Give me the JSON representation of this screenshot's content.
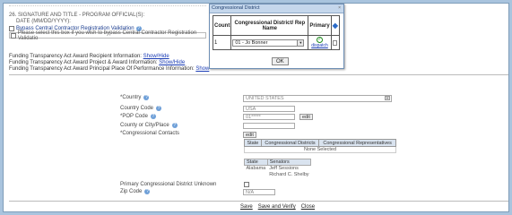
{
  "section": {
    "title": "26. SIGNATURE AND TITLE - PROGRAM OFFICIAL(S):",
    "date_label": "DATE (MM/DD/YYYY):",
    "bypass_title": "Bypass Central Contractor Registration Validation",
    "bypass_checkbox_label": "Please select this box if you wish to bypass Central Contractor Registration Validatio",
    "ffata": [
      {
        "label": "Funding Transparency Act Award Recipient Information:",
        "link": "Show/Hide"
      },
      {
        "label": "Funding Transparency Act Award Project & Award Information:",
        "link": "Show/Hide"
      },
      {
        "label": "Funding Transparency Act Award Principal Place Of Performance Information:",
        "link": "Show"
      }
    ]
  },
  "form": {
    "country_label": "*Country",
    "country_value": "UNITED STATES",
    "country_code_label": "Country Code",
    "country_code_value": "USA",
    "pop_code_label": "*POP Code",
    "pop_code_value": "01*****",
    "edit_label": "edit",
    "county_label": "County or City/Place",
    "congressional_contacts_label": "*Congressional Contacts",
    "contacts_edit_label": "edit",
    "cd_headers": [
      "State",
      "Congressional Districts",
      "Congressional Representatives"
    ],
    "cd_empty": "None Selected",
    "senators_headers": [
      "State",
      "Senators"
    ],
    "senators_state": "Alabama",
    "senators": [
      "Jeff Sessions",
      "Richard C. Shelby"
    ],
    "primary_unknown_label": "Primary Congressional District Unknown",
    "zip_label": "Zip Code",
    "zip_value": "N/A"
  },
  "actions": [
    "Save",
    "Save and Verify",
    "Close"
  ],
  "popup": {
    "title": "Congressional District",
    "close": "×",
    "headers": [
      "Count",
      "Congressional District/ Rep Name",
      "Primary"
    ],
    "row_count": "1",
    "row_select": "01 - Jo Bonner",
    "row_primary_link": "dispatch",
    "ok_label": "OK"
  },
  "colors": {
    "background": "#a9c4de",
    "header_fill": "#d9e3ef",
    "link": "#1a3cb5"
  }
}
